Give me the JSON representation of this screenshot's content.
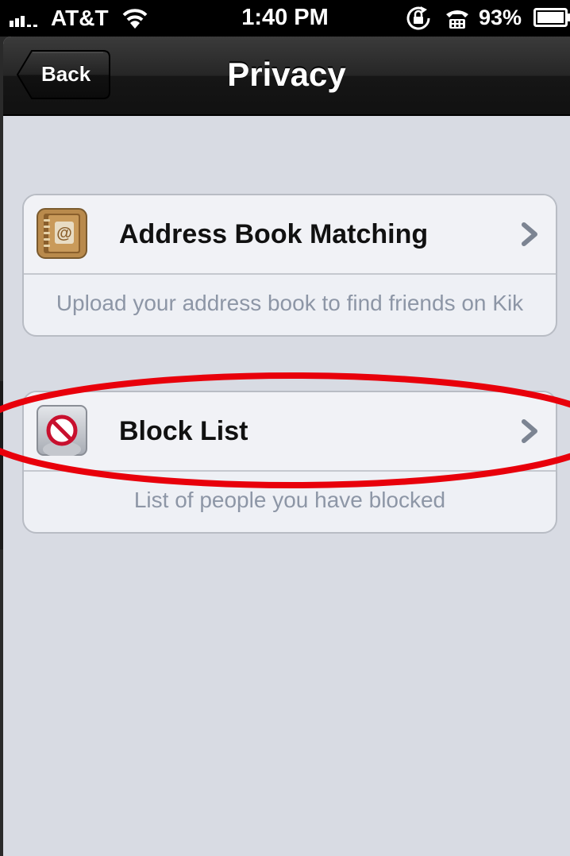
{
  "status_bar": {
    "carrier": "AT&T",
    "time": "1:40 PM",
    "battery_percent": "93%",
    "icons": [
      "signal-icon",
      "wifi-icon",
      "rotation-lock-icon",
      "tty-icon",
      "battery-icon"
    ]
  },
  "nav": {
    "back_label": "Back",
    "title": "Privacy"
  },
  "settings": {
    "address_book": {
      "label": "Address Book Matching",
      "description": "Upload your address book to find friends on Kik",
      "icon": "address-book-icon"
    },
    "block_list": {
      "label": "Block List",
      "description": "List of people you have blocked",
      "icon": "block-icon"
    }
  },
  "colors": {
    "background": "#d8dbe3",
    "description_text": "#8d96a6",
    "highlight_ellipse": "#e8000b"
  }
}
